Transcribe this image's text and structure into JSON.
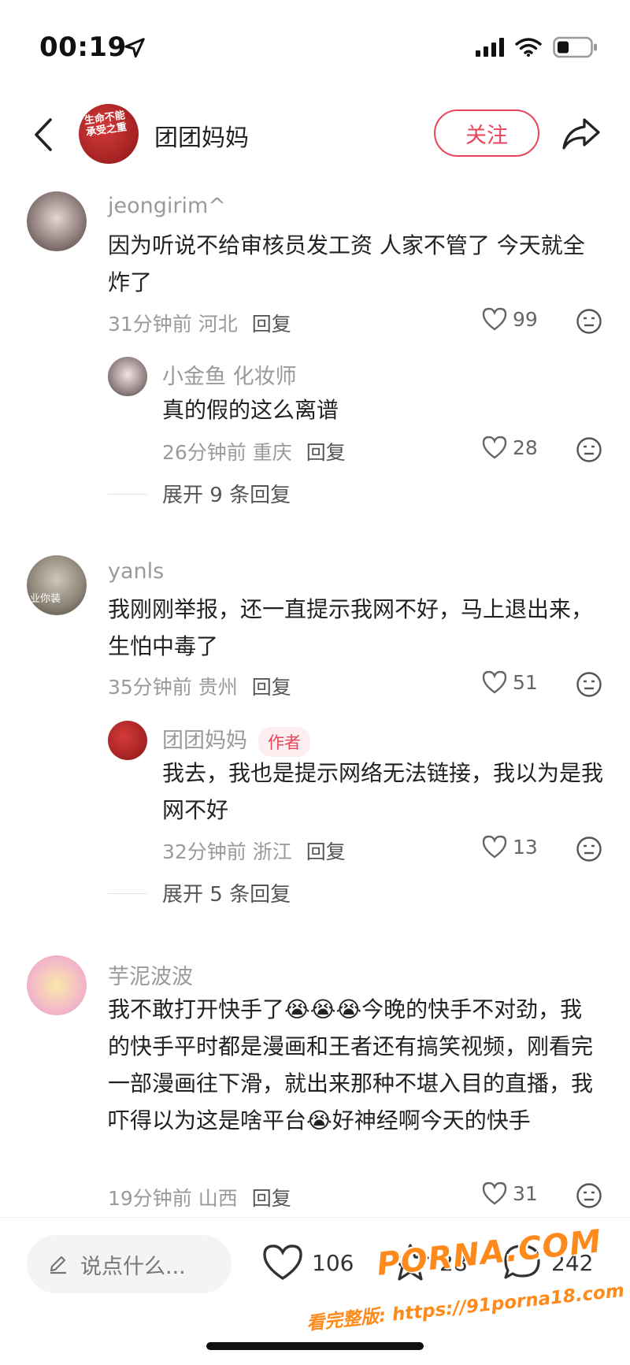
{
  "status": {
    "time": "00:19"
  },
  "header": {
    "name": "团团妈妈",
    "follow_label": "关注",
    "avatar_text": "生命不能承受之重"
  },
  "comments": [
    {
      "name": "jeongirim^",
      "text": "因为听说不给审核员发工资 人家不管了 今天就全炸了",
      "time_loc": "31分钟前 河北",
      "reply_label": "回复",
      "likes": "99",
      "replies": [
        {
          "name": "小金鱼 化妆师",
          "text": "真的假的这么离谱",
          "time_loc": "26分钟前 重庆",
          "reply_label": "回复",
          "likes": "28"
        }
      ],
      "expand_label": "展开 9 条回复"
    },
    {
      "name": "yanls",
      "text": "我刚刚举报，还一直提示我网不好，马上退出来，生怕中毒了",
      "time_loc": "35分钟前 贵州",
      "reply_label": "回复",
      "likes": "51",
      "avatar_text": "业你装",
      "replies": [
        {
          "name": "团团妈妈",
          "tag": "作者",
          "text": "我去，我也是提示网络无法链接，我以为是我网不好",
          "time_loc": "32分钟前 浙江",
          "reply_label": "回复",
          "likes": "13"
        }
      ],
      "expand_label": "展开 5 条回复"
    },
    {
      "name": "芋泥波波",
      "text_parts": [
        "我不敢打开快手了",
        "今晚的快手不对劲，我的快手平时都是漫画和王者还有搞笑视频，刚看完一部漫画往下滑，就出来那种不堪入目的直播，我吓得以为这是啥平台",
        "好神经啊今天的快手"
      ],
      "time_loc": "19分钟前 山西",
      "reply_label": "回复",
      "likes": "31"
    }
  ],
  "bottom": {
    "input_placeholder": "说点什么...",
    "likes": "106",
    "favorites": "28",
    "comments": "242"
  },
  "watermark": {
    "line1": "PORNA.COM",
    "line2": "看完整版: https://91porna18.com"
  },
  "colors": {
    "accent": "#e8455b",
    "watermark": "#ff8a1c"
  }
}
